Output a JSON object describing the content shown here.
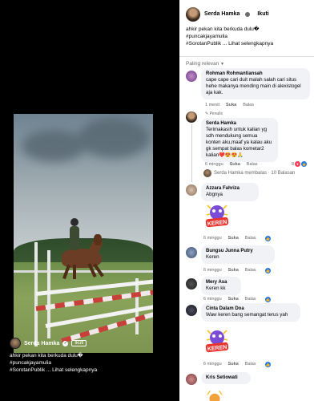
{
  "video_caption": {
    "author": "Serda Hamka",
    "follow_label": "Ikuti",
    "text_line1": "ahkir pekan kita berkuda dulu�",
    "text_line2": "#puncakjayamulia",
    "text_line3": "#SorotanPublik ... Lihat selengkapnya"
  },
  "post": {
    "author": "Serda Hamka",
    "follow_label": "Ikuti",
    "text_line1": "ahkir pekan kita berkuda dulu�",
    "text_line2": "#puncakjayamulia",
    "text_line3": "#SorotanPublik ... Lihat selengkapnya"
  },
  "sort_label": "Paling relevan",
  "comments": [
    {
      "name": "Rohman Rohmantiansah",
      "text": "cape cape cari duit malah salah cari situs hehe makanya mending main di alexistogel aja kak.",
      "time": "1 menit",
      "like": "Suka",
      "reply": "Balas"
    },
    {
      "pinned": "Penulis",
      "name": "Serda Hamka",
      "text": "Terimakasih untuk kalian yg sdh mendukung semua konten aku,maaf ya kalau aku gk sempat balas kometar2 kalian❤️😍😍🙏",
      "time": "6 minggu",
      "like": "Suka",
      "reply": "Balas",
      "reaction_count": "8",
      "replies_label": "Serda Hamka membalas · 10 Balasan"
    },
    {
      "name": "Azzara Fahriza",
      "text": "Abgnya",
      "time": "6 minggu",
      "like": "Suka",
      "reply": "Balas",
      "sticker_text": "KEREN"
    },
    {
      "name": "Bungsu Junna Putry",
      "text": "Keren",
      "time": "6 minggu",
      "like": "Suka",
      "reply": "Balas"
    },
    {
      "name": "Mery Asa",
      "text": "Keren kk",
      "time": "6 minggu",
      "like": "Suka",
      "reply": "Balas"
    },
    {
      "name": "Cinta Dalam Doa",
      "text": "Waw keren bang semangat terus yah",
      "time": "6 minggu",
      "like": "Suka",
      "reply": "Balas",
      "sticker_text": "KEREN"
    },
    {
      "name": "Kris Setiowati",
      "text": ""
    }
  ],
  "colors": {
    "like_blue": "#1877f2",
    "bubble_bg": "#f0f2f5",
    "meta_gray": "#65676b"
  }
}
